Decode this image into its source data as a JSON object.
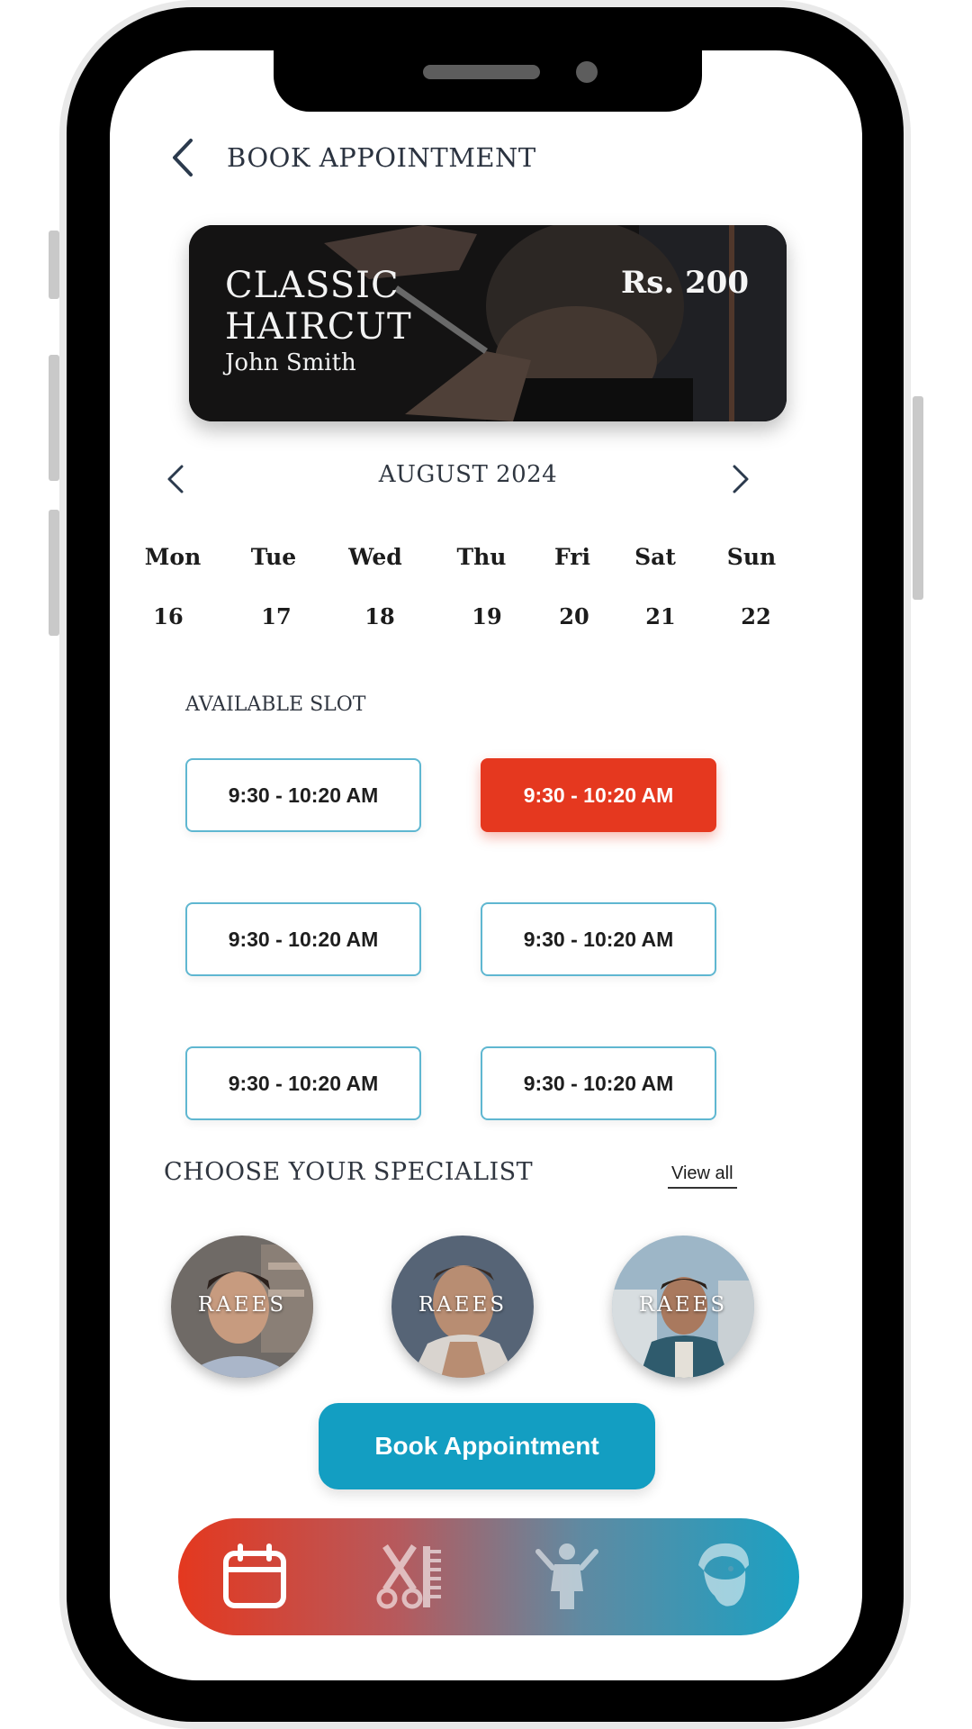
{
  "header": {
    "title": "BOOK APPOINTMENT"
  },
  "service": {
    "title": "CLASSIC\nHAIRCUT",
    "stylist": "John Smith",
    "price": "Rs. 200"
  },
  "calendar": {
    "month": "AUGUST 2024",
    "days": [
      {
        "name": "Mon",
        "num": "16"
      },
      {
        "name": "Tue",
        "num": "17"
      },
      {
        "name": "Wed",
        "num": "18"
      },
      {
        "name": "Thu",
        "num": "19"
      },
      {
        "name": "Fri",
        "num": "20"
      },
      {
        "name": "Sat",
        "num": "21"
      },
      {
        "name": "Sun",
        "num": "22"
      }
    ]
  },
  "slots": {
    "label": "AVAILABLE SLOT",
    "items": [
      {
        "time": "9:30 - 10:20 AM",
        "selected": false
      },
      {
        "time": "9:30 - 10:20 AM",
        "selected": true
      },
      {
        "time": "9:30 - 10:20 AM",
        "selected": false
      },
      {
        "time": "9:30 - 10:20 AM",
        "selected": false
      },
      {
        "time": "9:30 - 10:20 AM",
        "selected": false
      },
      {
        "time": "9:30 - 10:20 AM",
        "selected": false
      }
    ]
  },
  "specialists": {
    "label": "CHOOSE YOUR SPECIALIST",
    "view_all": "View all",
    "items": [
      {
        "name": "RAEES"
      },
      {
        "name": "RAEES"
      },
      {
        "name": "RAEES"
      }
    ]
  },
  "book_button": "Book Appointment",
  "bottom_nav": {
    "items": [
      {
        "icon": "calendar-icon",
        "active": true
      },
      {
        "icon": "scissors-comb-icon",
        "active": false
      },
      {
        "icon": "barber-person-icon",
        "active": false
      },
      {
        "icon": "bearded-man-icon",
        "active": false
      }
    ]
  },
  "colors": {
    "accent_red": "#e5381f",
    "accent_blue": "#139ec2",
    "slot_border": "#5fb7d1"
  }
}
